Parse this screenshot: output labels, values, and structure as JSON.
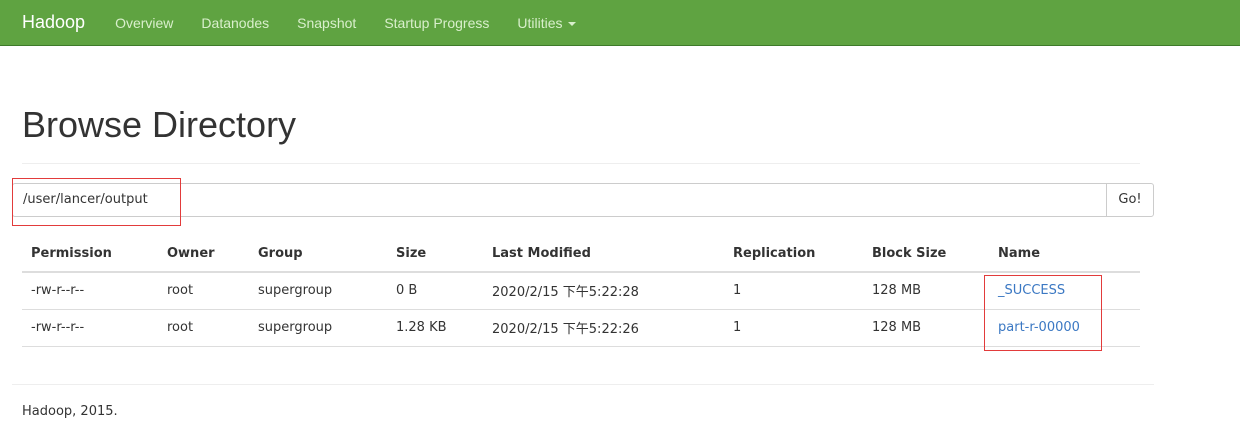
{
  "navbar": {
    "brand": "Hadoop",
    "links": [
      "Overview",
      "Datanodes",
      "Snapshot",
      "Startup Progress",
      "Utilities"
    ]
  },
  "page": {
    "title": "Browse Directory"
  },
  "path_bar": {
    "value": "/user/lancer/output",
    "go_label": "Go!"
  },
  "table": {
    "headers": [
      "Permission",
      "Owner",
      "Group",
      "Size",
      "Last Modified",
      "Replication",
      "Block Size",
      "Name"
    ],
    "rows": [
      [
        "-rw-r--r--",
        "root",
        "supergroup",
        "0 B",
        "2020/2/15 下午5:22:28",
        "1",
        "128 MB",
        "_SUCCESS"
      ],
      [
        "-rw-r--r--",
        "root",
        "supergroup",
        "1.28 KB",
        "2020/2/15 下午5:22:26",
        "1",
        "128 MB",
        "part-r-00000"
      ]
    ]
  },
  "footer": {
    "text": "Hadoop, 2015."
  },
  "colors": {
    "navbar_bg": "#5fa341",
    "link": "#3b78c3",
    "annotation": "#e23b3b"
  }
}
